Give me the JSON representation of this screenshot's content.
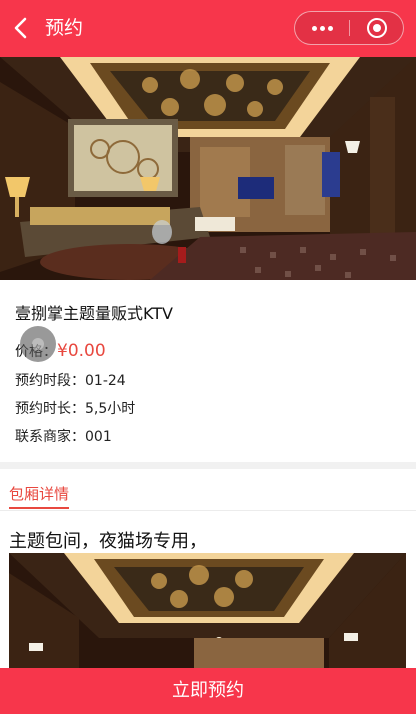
{
  "navbar": {
    "title": "预约",
    "back_icon": "chevron-left-icon",
    "more_icon": "more-dots-icon",
    "close_icon": "target-circle-icon",
    "color": "#f7364b"
  },
  "room": {
    "name": "壹捌掌主题量贩式KTV",
    "price_label": "价格：",
    "price_value": "¥0.00",
    "time_slot_label": "预约时段：",
    "time_slot_value": "01-24",
    "duration_label": "预约时长：",
    "duration_value": "5,5小时",
    "merchant_label": "联系商家：",
    "merchant_value": "001"
  },
  "detail": {
    "tab_label": "包厢详情",
    "description": "主题包间，夜猫场专用，"
  },
  "footer": {
    "book_button": "立即预约"
  },
  "colors": {
    "accent": "#f7364b",
    "price": "#e8483f"
  }
}
